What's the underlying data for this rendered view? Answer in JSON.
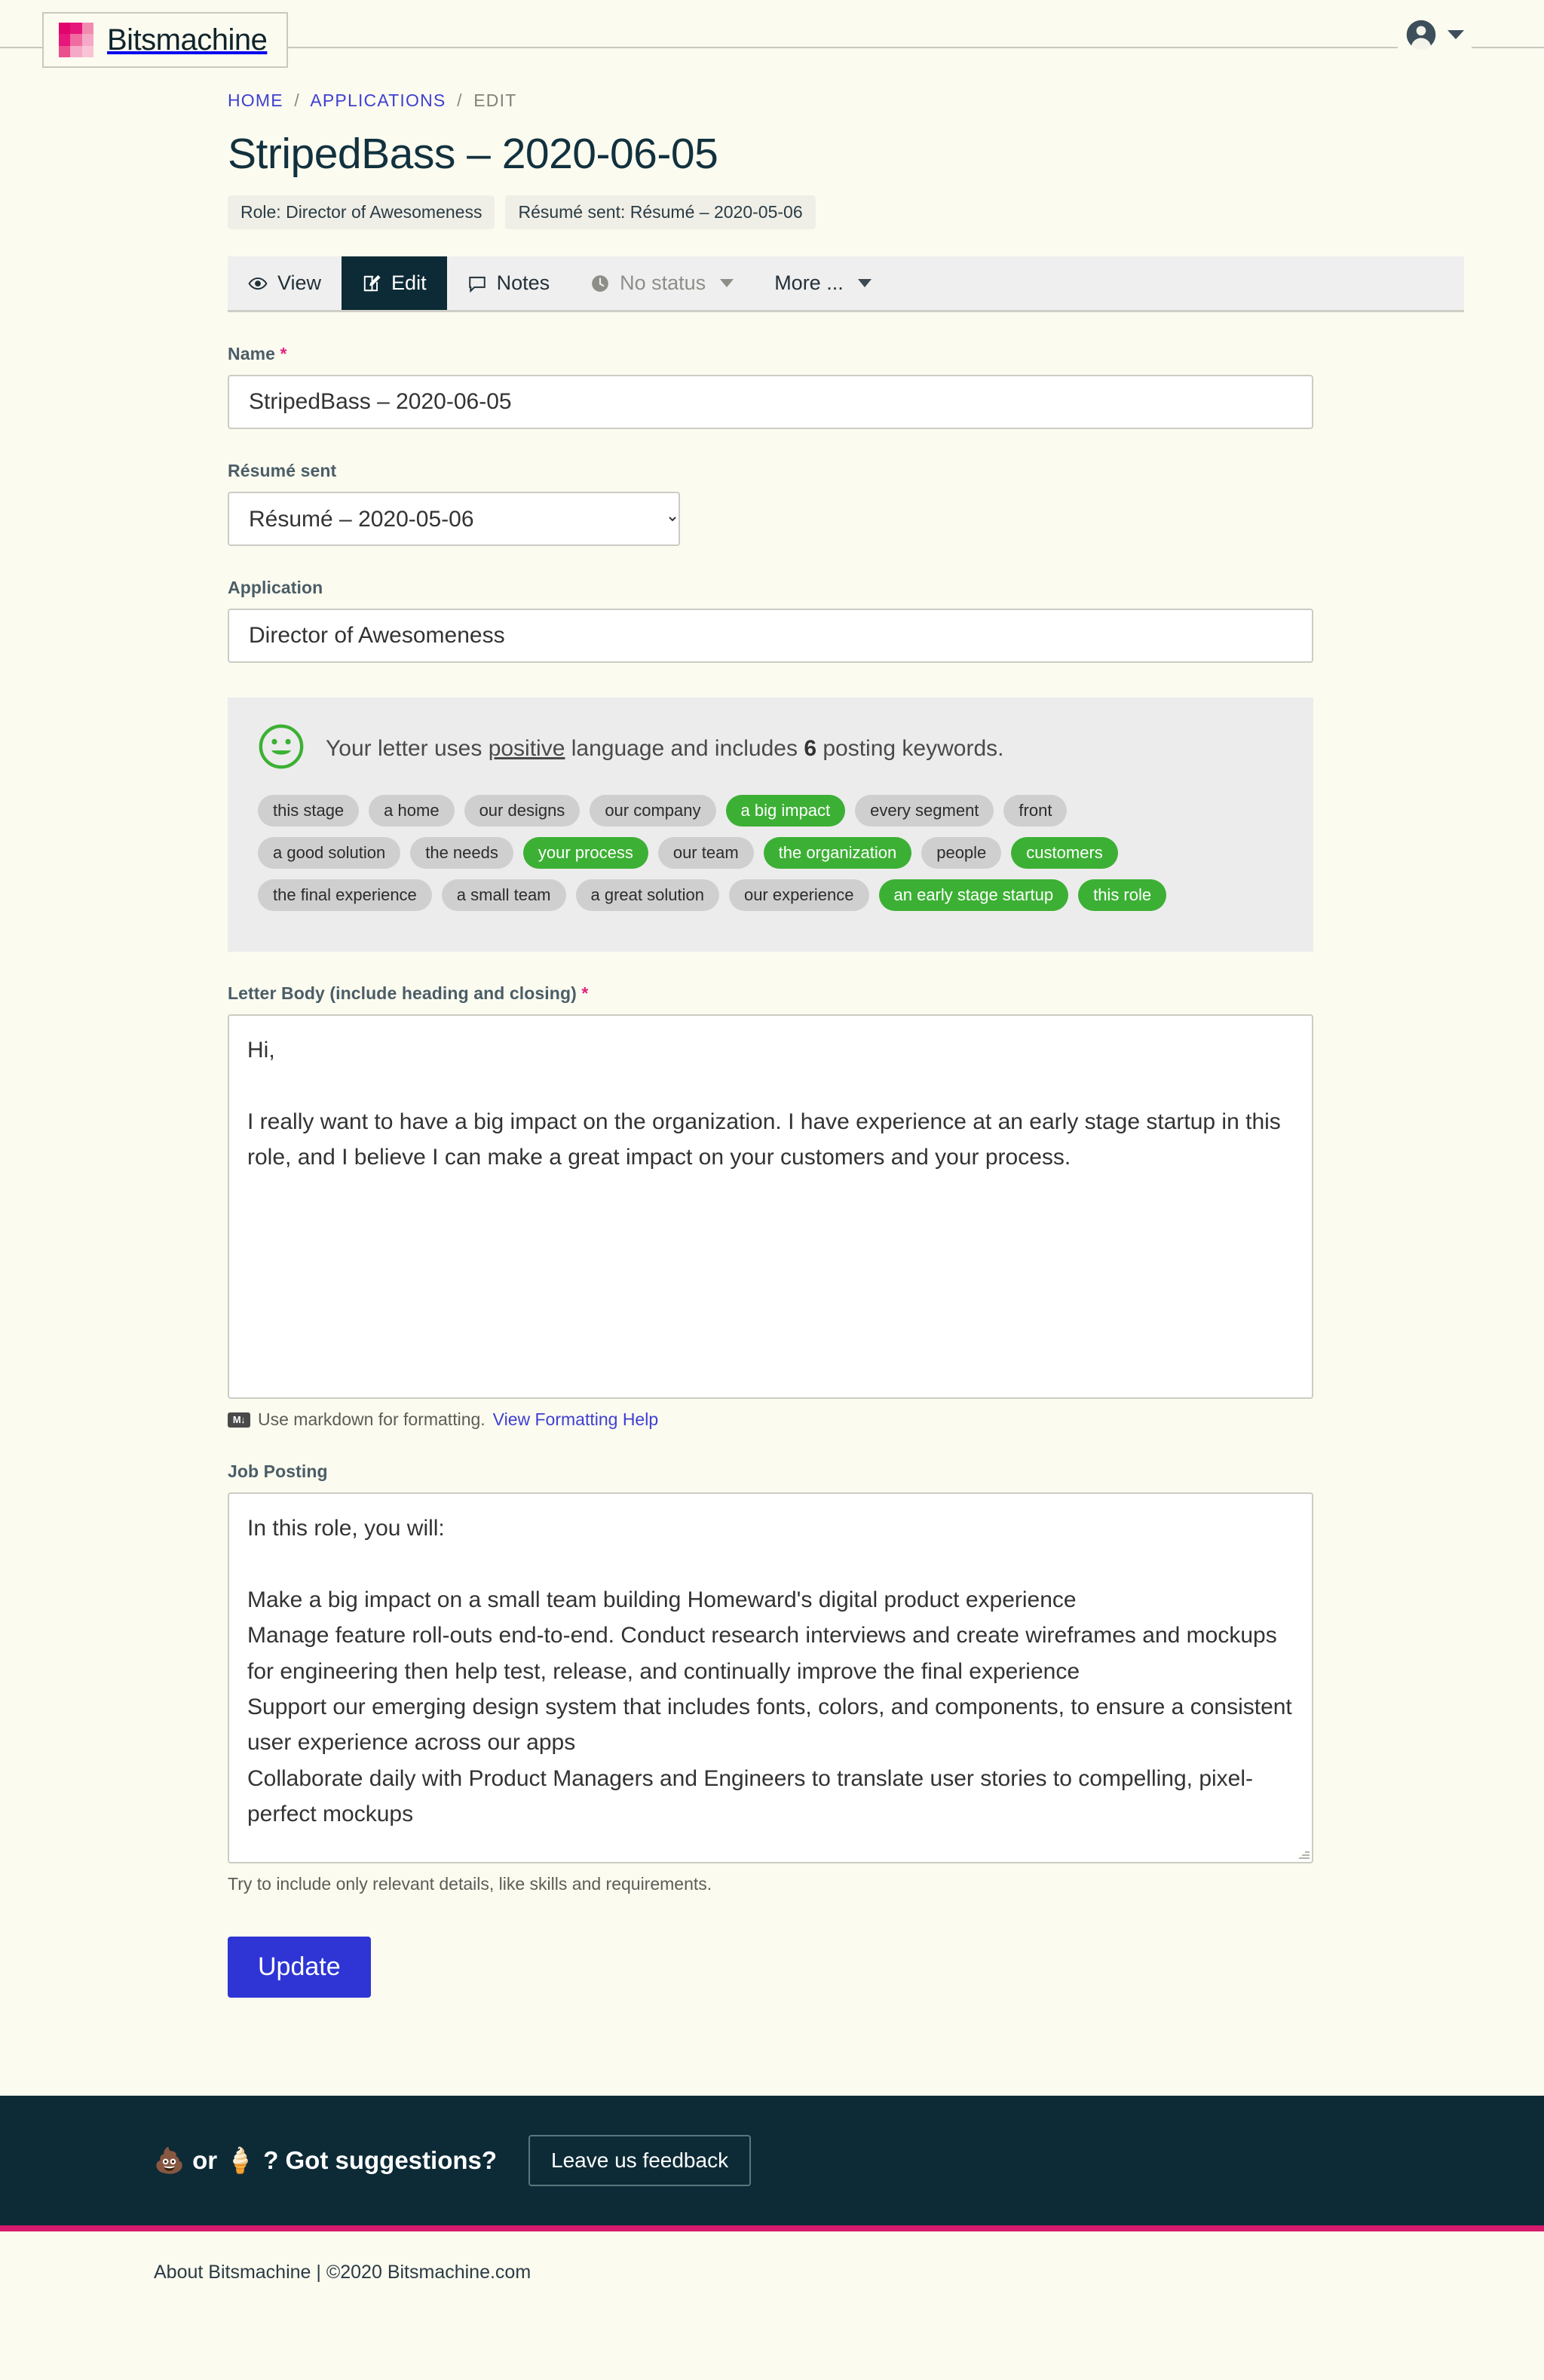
{
  "header": {
    "brand_name": "Bitsmachine",
    "logo_colors": [
      "#e0046b",
      "#e6167c",
      "#f28bb0",
      "#e6167c",
      "#f06ca0",
      "#f6a9c6",
      "#ec4f8e",
      "#f6a9c6",
      "#f9c3d6"
    ],
    "avatar_icon": "user-circle-icon",
    "caret_icon": "chevron-down-icon"
  },
  "breadcrumb": {
    "home": "HOME",
    "applications": "APPLICATIONS",
    "current": "EDIT",
    "separator": "/"
  },
  "title": "StripedBass – 2020-06-05",
  "badges": [
    "Role: Director of Awesomeness",
    "Résumé sent: Résumé – 2020-05-06"
  ],
  "tabs": [
    {
      "label": "View",
      "icon": "eye-icon",
      "active": false,
      "muted": false,
      "caret": false
    },
    {
      "label": "Edit",
      "icon": "pencil-square-icon",
      "active": true,
      "muted": false,
      "caret": false
    },
    {
      "label": "Notes",
      "icon": "comment-icon",
      "active": false,
      "muted": false,
      "caret": false
    },
    {
      "label": "No status",
      "icon": "clock-icon",
      "active": false,
      "muted": true,
      "caret": true
    },
    {
      "label": "More ...",
      "icon": "",
      "active": false,
      "muted": false,
      "caret": true
    }
  ],
  "form": {
    "name": {
      "label": "Name",
      "required_marker": "*",
      "value": "StripedBass – 2020-06-05"
    },
    "resume_sent": {
      "label": "Résumé sent",
      "value": "Résumé – 2020-05-06",
      "options": [
        "Résumé – 2020-05-06"
      ]
    },
    "application": {
      "label": "Application",
      "value": "Director of Awesomeness"
    },
    "letter_body": {
      "label": "Letter Body (include heading and closing)",
      "required_marker": "*",
      "value": "Hi,\n\nI really want to have a big impact on the organization. I have experience at an early stage startup in this role, and I believe I can make a great impact on your customers and your process."
    },
    "job_posting": {
      "label": "Job Posting",
      "value": "In this role, you will:\n\nMake a big impact on a small team building Homeward's digital product experience\nManage feature roll-outs end-to-end. Conduct research interviews and create wireframes and mockups for engineering then help test, release, and continually improve the final experience\nSupport our emerging design system that includes fonts, colors, and components, to ensure a consistent user experience across our apps\nCollaborate daily with Product Managers and Engineers to translate user stories to compelling, pixel-perfect mockups",
      "hint": "Try to include only relevant details, like skills and requirements."
    },
    "markdown_help": {
      "badge": "M↓",
      "text": "Use markdown for formatting.",
      "link": "View Formatting Help"
    },
    "submit_label": "Update"
  },
  "analysis": {
    "icon": "smiley-face-icon",
    "message_prefix": "Your letter uses ",
    "message_underlined": "positive",
    "message_middle": " language and includes ",
    "keyword_count": "6",
    "message_suffix": " posting keywords.",
    "accent_green": "#3cb034",
    "tag_rows": [
      [
        {
          "text": "this stage",
          "hit": false
        },
        {
          "text": "a home",
          "hit": false
        },
        {
          "text": "our designs",
          "hit": false
        },
        {
          "text": "our company",
          "hit": false
        },
        {
          "text": "a big impact",
          "hit": true
        },
        {
          "text": "every segment",
          "hit": false
        },
        {
          "text": "front",
          "hit": false
        }
      ],
      [
        {
          "text": "a good solution",
          "hit": false
        },
        {
          "text": "the needs",
          "hit": false
        },
        {
          "text": "your process",
          "hit": true
        },
        {
          "text": "our team",
          "hit": false
        },
        {
          "text": "the organization",
          "hit": true
        },
        {
          "text": "people",
          "hit": false
        },
        {
          "text": "customers",
          "hit": true
        }
      ],
      [
        {
          "text": "the final experience",
          "hit": false
        },
        {
          "text": "a small team",
          "hit": false
        },
        {
          "text": "a great solution",
          "hit": false
        },
        {
          "text": "our experience",
          "hit": false
        },
        {
          "text": "an early stage startup",
          "hit": true
        },
        {
          "text": "this role",
          "hit": true
        }
      ]
    ]
  },
  "footer": {
    "slogan_poop": "💩",
    "slogan_mid": " or ",
    "slogan_cone": "🍦",
    "slogan_end": "? Got suggestions?",
    "feedback_label": "Leave us feedback",
    "about": "About Bitsmachine | ©2020 Bitsmachine.com",
    "accent_pink": "#d61a6e"
  }
}
